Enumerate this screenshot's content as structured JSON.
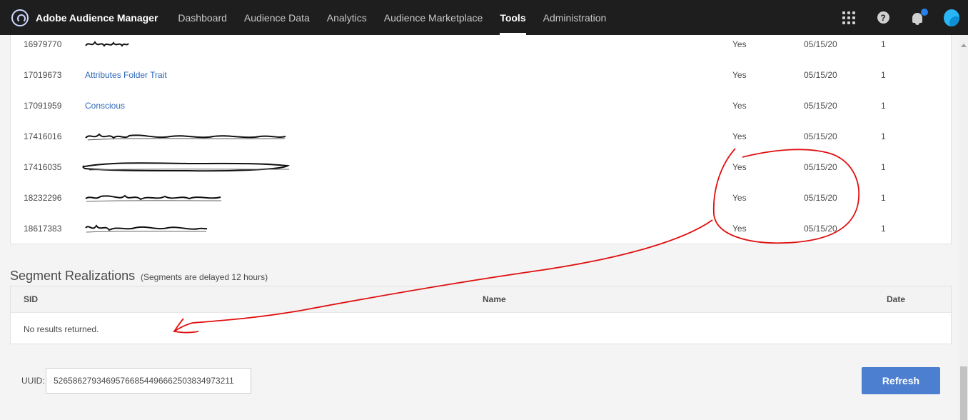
{
  "topbar": {
    "brand": "Adobe Audience Manager",
    "nav": [
      "Dashboard",
      "Audience Data",
      "Analytics",
      "Audience Marketplace",
      "Tools",
      "Administration"
    ],
    "active_nav": "Tools",
    "icons": [
      "apps-grid-icon",
      "help-icon",
      "notification-bell-icon",
      "user-avatar"
    ],
    "accent": "#2680eb"
  },
  "traits": {
    "rows": [
      {
        "id": "16979770",
        "name": "",
        "realized": "Yes",
        "date": "05/15/20",
        "count": "1"
      },
      {
        "id": "17019673",
        "name": "Attributes Folder Trait",
        "realized": "Yes",
        "date": "05/15/20",
        "count": "1"
      },
      {
        "id": "17091959",
        "name": "Conscious",
        "realized": "Yes",
        "date": "05/15/20",
        "count": "1"
      },
      {
        "id": "17416016",
        "name": "",
        "realized": "Yes",
        "date": "05/15/20",
        "count": "1"
      },
      {
        "id": "17416035",
        "name": "",
        "realized": "Yes",
        "date": "05/15/20",
        "count": "1"
      },
      {
        "id": "18232296",
        "name": "",
        "realized": "Yes",
        "date": "05/15/20",
        "count": "1"
      },
      {
        "id": "18617383",
        "name": "",
        "realized": "Yes",
        "date": "05/15/20",
        "count": "1"
      }
    ]
  },
  "segments": {
    "title": "Segment Realizations",
    "note": "(Segments are delayed 12 hours)",
    "columns": {
      "sid": "SID",
      "name": "Name",
      "date": "Date"
    },
    "empty": "No results returned."
  },
  "uuid": {
    "label": "UUID:",
    "value": "52658627934695766854496662503834973211"
  },
  "refresh_label": "Refresh"
}
